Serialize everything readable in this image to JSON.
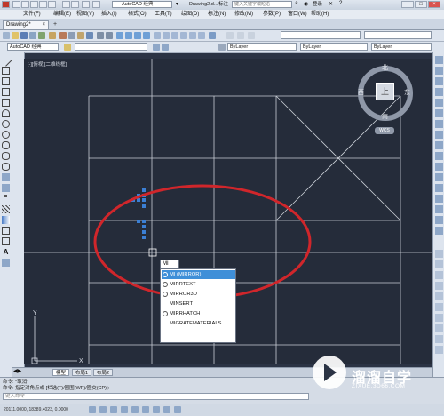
{
  "titlebar": {
    "workspace": "AutoCAD 经典",
    "file_title": "Drawing2.d...",
    "title_extra": "标注",
    "search_placeholder": "键入关键字或短语",
    "login": "登录"
  },
  "menu": [
    "文件(F)",
    "编辑(E)",
    "视图(V)",
    "插入(I)",
    "格式(O)",
    "工具(T)",
    "绘图(D)",
    "标注(N)",
    "修改(M)",
    "参数(P)",
    "窗口(W)",
    "帮助(H)"
  ],
  "tabs": {
    "document": "Drawing2*",
    "add": "+"
  },
  "toolbar2": {
    "workspace_combo": "AutoCAD 经典",
    "layer_combo": "ByLayer",
    "linetype_combo": "ByLayer",
    "lineweight_combo": "ByLayer"
  },
  "viewport_label": "[-][俯视][二维线框]",
  "viewcube": {
    "north": "北",
    "south": "南",
    "east": "东",
    "west": "西",
    "top": "上",
    "wcs": "WCS"
  },
  "autocomplete": {
    "input": "MI",
    "items": [
      "MI (MIRROR)",
      "MIRRTEXT",
      "MIRROR3D",
      "MINSERT",
      "MIRRHATCH",
      "MIGRATEMATERIALS"
    ]
  },
  "model_tabs": [
    "模型",
    "布局1",
    "布局2"
  ],
  "command_lines": [
    "命令: *取消*",
    "命令: 指定对角点或 [栏选(F)/圈围(WP)/圈交(CP)]:"
  ],
  "command_prompt": "键入命令",
  "coords": "20111.0000, 18389.4023, 0.0000",
  "watermark": {
    "title": "溜溜自学",
    "url": "ZIXUE.3D66.COM"
  }
}
